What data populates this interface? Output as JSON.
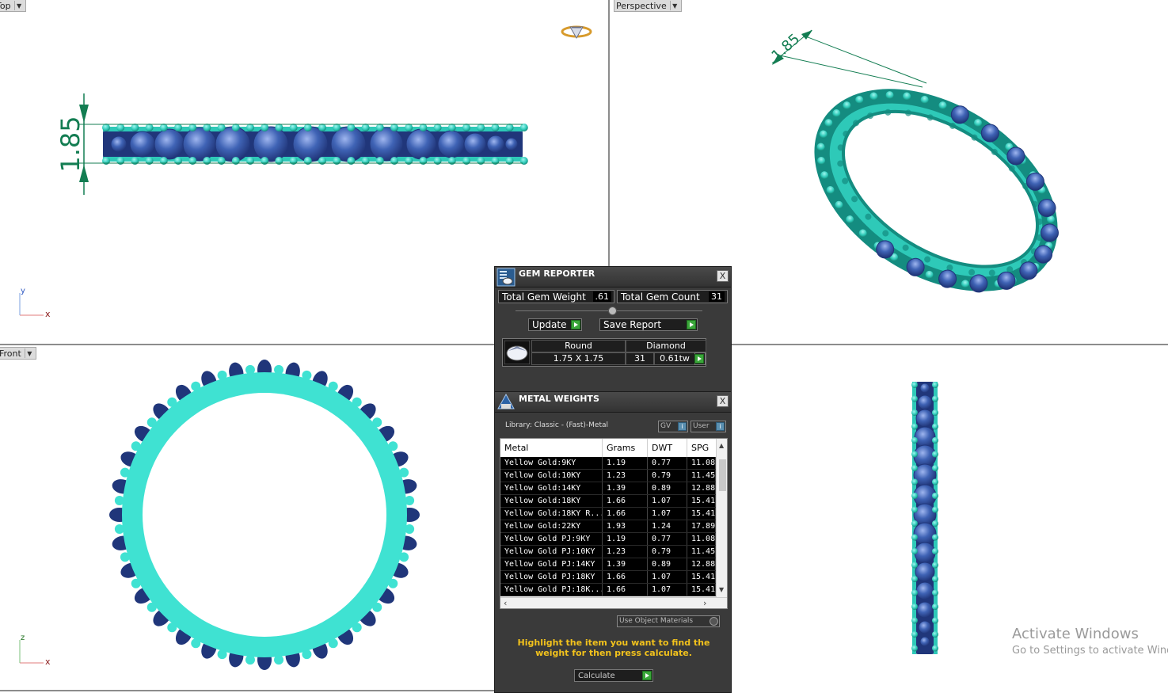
{
  "viewports": {
    "top": {
      "label": "Top",
      "axis_a": "y",
      "axis_b": "x",
      "dimension": "1.85"
    },
    "perspective": {
      "label": "Perspective",
      "dimension": "1.85"
    },
    "front": {
      "label": "Front",
      "axis_a": "z",
      "axis_b": "x"
    }
  },
  "colors": {
    "metal": "#2ec9b8",
    "metal_light": "#3fe2d2",
    "metal_dark": "#148c80",
    "gem": "#3f63b5",
    "gem_dark": "#20367a",
    "dimension": "#137d52"
  },
  "gem_reporter": {
    "title": "GEM REPORTER",
    "close": "X",
    "total_gem_weight_label": "Total Gem Weight",
    "total_gem_weight_value": ".61",
    "total_gem_count_label": "Total Gem Count",
    "total_gem_count_value": "31",
    "update_label": "Update",
    "save_report_label": "Save Report",
    "gem_row": {
      "shape": "Round",
      "type": "Diamond",
      "size": "1.75 X 1.75",
      "count": "31",
      "weight": "0.61tw"
    }
  },
  "metal_weights": {
    "title": "METAL WEIGHTS",
    "close": "X",
    "library": "Library: Classic - (Fast)-Metal",
    "gv_label": "GV",
    "user_label": "User",
    "columns": [
      "Metal",
      "Grams",
      "DWT",
      "SPG"
    ],
    "rows": [
      [
        "Yellow Gold:9KY",
        "1.19",
        "0.77",
        "11.08"
      ],
      [
        "Yellow Gold:10KY",
        "1.23",
        "0.79",
        "11.45"
      ],
      [
        "Yellow Gold:14KY",
        "1.39",
        "0.89",
        "12.88"
      ],
      [
        "Yellow Gold:18KY",
        "1.66",
        "1.07",
        "15.41"
      ],
      [
        "Yellow Gold:18KY R...",
        "1.66",
        "1.07",
        "15.41"
      ],
      [
        "Yellow Gold:22KY",
        "1.93",
        "1.24",
        "17.89"
      ],
      [
        "Yellow Gold PJ:9KY",
        "1.19",
        "0.77",
        "11.08"
      ],
      [
        "Yellow Gold PJ:10KY",
        "1.23",
        "0.79",
        "11.45"
      ],
      [
        "Yellow Gold PJ:14KY",
        "1.39",
        "0.89",
        "12.88"
      ],
      [
        "Yellow Gold PJ:18KY",
        "1.66",
        "1.07",
        "15.41"
      ],
      [
        "Yellow Gold PJ:18K...",
        "1.66",
        "1.07",
        "15.41"
      ]
    ],
    "use_object_materials": "Use Object Materials",
    "hint": "Highlight the item you want to find the weight for then press calculate.",
    "calculate_label": "Calculate"
  },
  "watermark": {
    "line1": "Activate Windows",
    "line2": "Go to Settings to activate Windows."
  }
}
